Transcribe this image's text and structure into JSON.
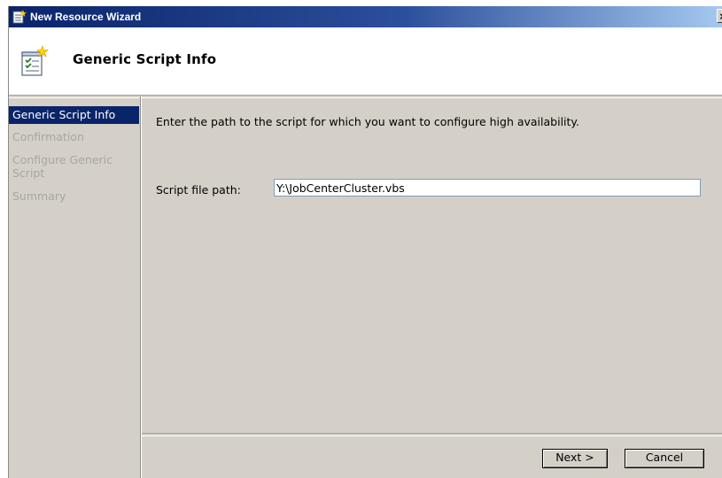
{
  "window": {
    "title": "New Resource Wizard",
    "close_glyph": "×"
  },
  "header": {
    "title": "Generic Script Info",
    "icon": "script-wizard-icon"
  },
  "sidebar": {
    "items": [
      {
        "label": "Generic Script Info",
        "active": true
      },
      {
        "label": "Confirmation",
        "active": false
      },
      {
        "label": "Configure Generic Script",
        "active": false
      },
      {
        "label": "Summary",
        "active": false
      }
    ]
  },
  "main": {
    "instruction": "Enter the path to the script for which you want to configure high availability.",
    "script_path_label": "Script file path:",
    "script_path_value": "Y:\\JobCenterCluster.vbs"
  },
  "buttons": {
    "next": "Next >",
    "cancel": "Cancel"
  },
  "colors": {
    "titlebar_start": "#0a246a",
    "titlebar_end": "#a6caf0",
    "selection": "#0a246a",
    "dialog_bg": "#d4d0c8",
    "disabled_text": "#a8a6a0"
  }
}
